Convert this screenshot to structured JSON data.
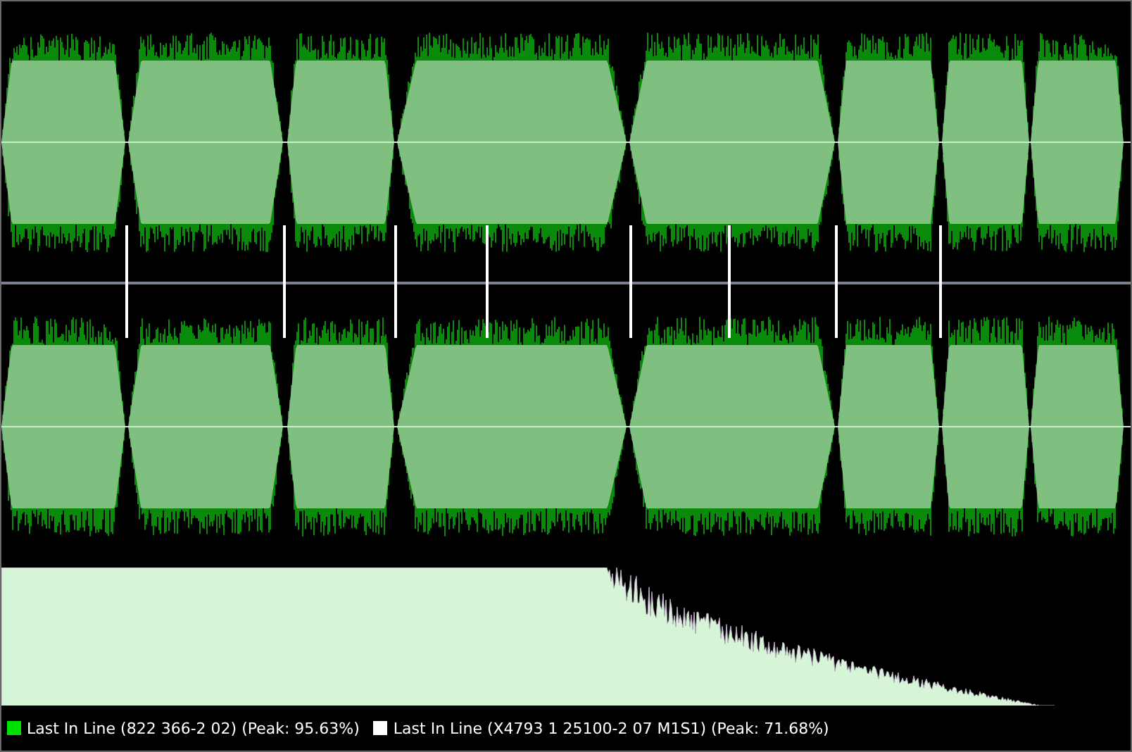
{
  "legend": [
    {
      "label": "Last In Line (822 366-2 02) (Peak: 95.63%)",
      "color": "#00e000"
    },
    {
      "label": "Last In Line (X4793 1 25100-2 07 M1S1) (Peak: 71.68%)",
      "color": "#ffffff"
    }
  ]
}
